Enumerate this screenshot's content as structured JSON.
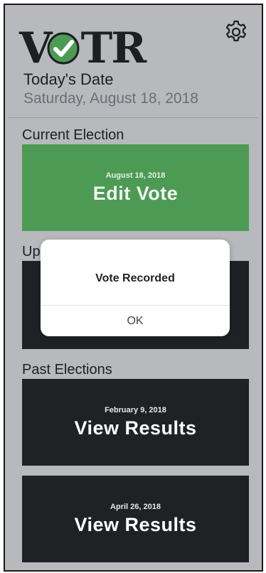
{
  "app": {
    "logo_left": "V",
    "logo_right": "TR",
    "logo_icon": "check-circle-icon",
    "accent_color": "#4d9a55",
    "settings_icon": "gear-icon"
  },
  "today": {
    "label": "Today's Date",
    "value": "Saturday, August 18, 2018"
  },
  "current": {
    "title": "Current Election",
    "date": "August 18, 2018",
    "action": "Edit Vote"
  },
  "upcoming": {
    "title": "Up"
  },
  "past": {
    "title": "Past Elections",
    "items": [
      {
        "date": "February 9, 2018",
        "action": "View Results"
      },
      {
        "date": "April 26, 2018",
        "action": "View Results"
      }
    ]
  },
  "dialog": {
    "message": "Vote Recorded",
    "ok_label": "OK"
  }
}
